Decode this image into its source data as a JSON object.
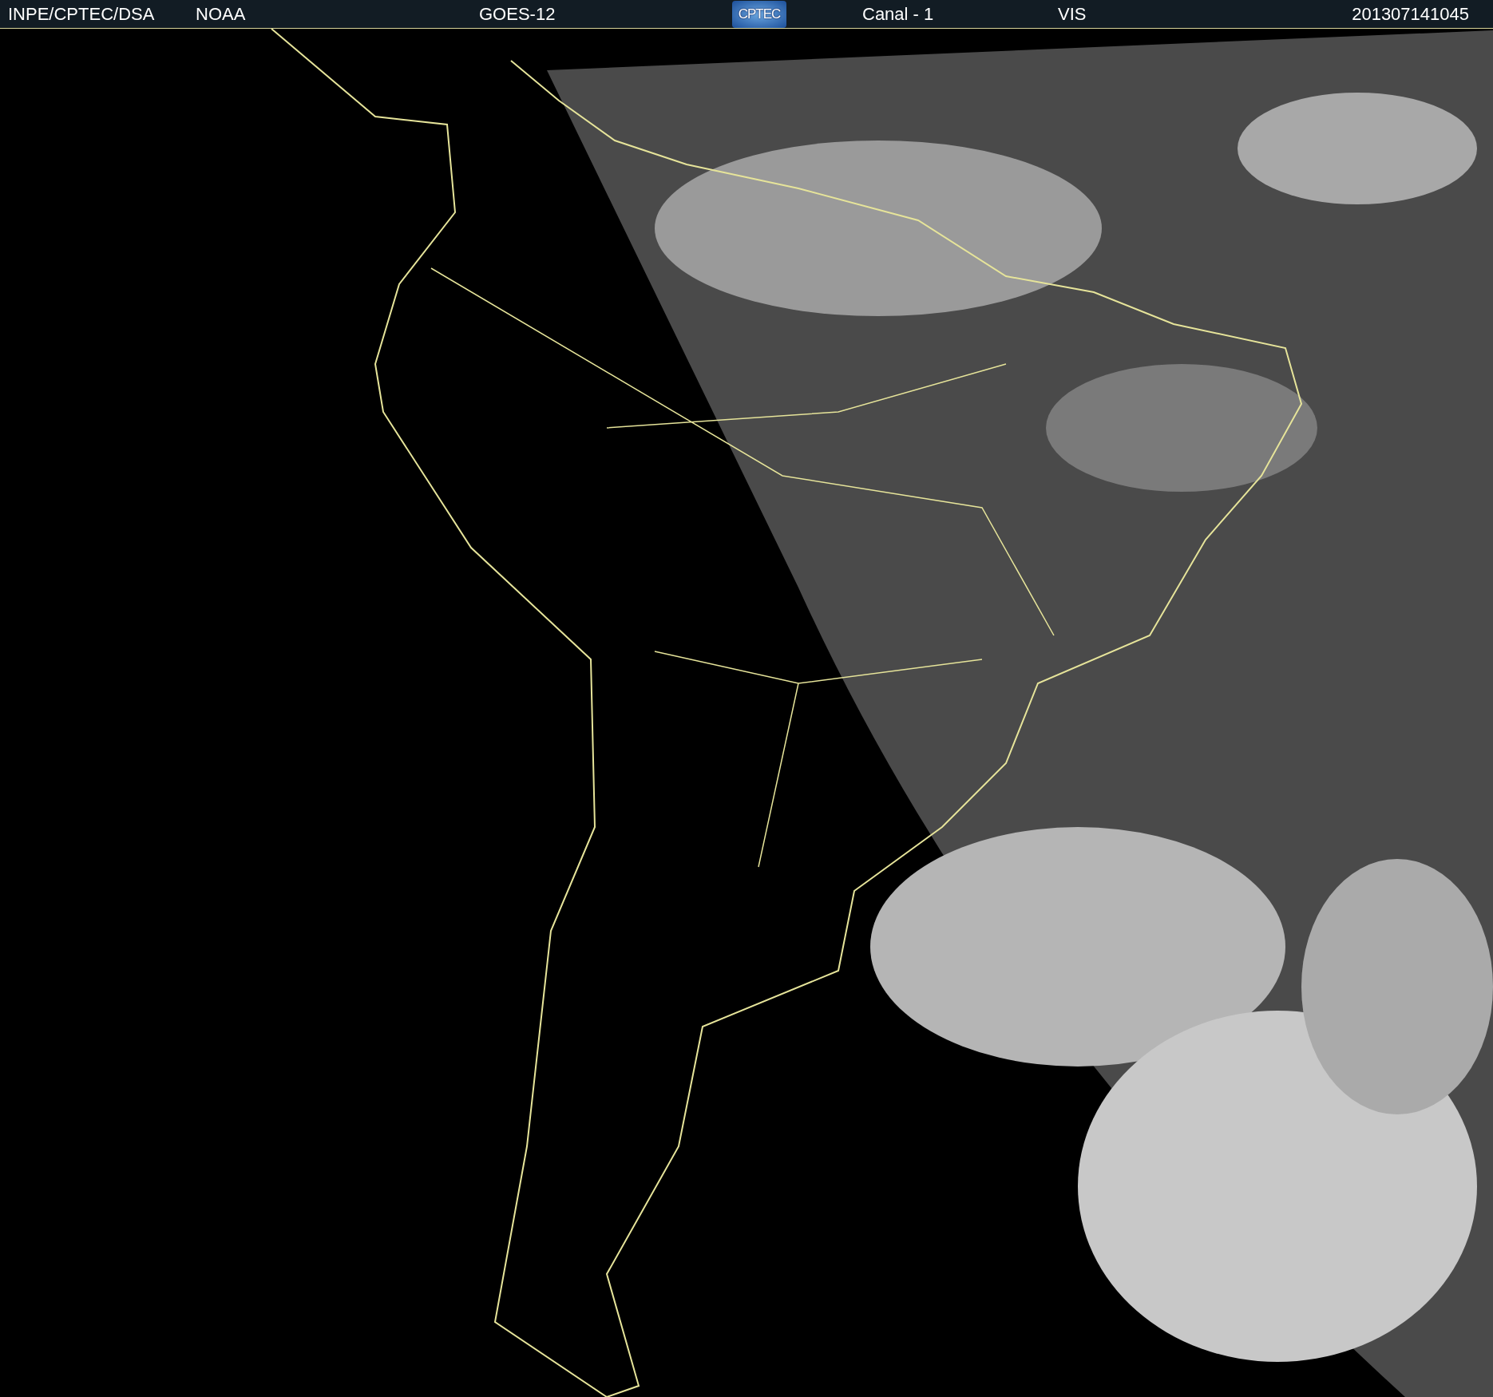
{
  "header": {
    "agency": "INPE/CPTEC/DSA",
    "source": "NOAA",
    "satellite": "GOES-12",
    "logo": "CPTEC",
    "channel": "Canal - 1",
    "band": "VIS",
    "timestamp": "201307141045"
  }
}
